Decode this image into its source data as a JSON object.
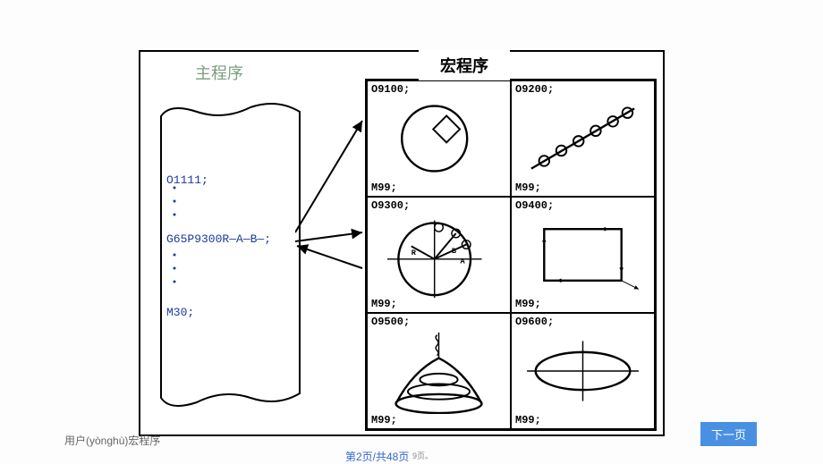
{
  "labels": {
    "main_prog": "主程序",
    "macro_prog": "宏程序"
  },
  "main_program": {
    "prog_num": "O1111;",
    "call_line": "G65P9300R—A—B—;",
    "end": "M30;"
  },
  "cells": [
    {
      "top": "O9100;",
      "bot": "M99;"
    },
    {
      "top": "O9200;",
      "bot": "M99;"
    },
    {
      "top": "O9300;",
      "bot": "M99;"
    },
    {
      "top": "O9400;",
      "bot": "M99;"
    },
    {
      "top": "O9500;",
      "bot": "M99;"
    },
    {
      "top": "O9600;",
      "bot": "M99;"
    }
  ],
  "footer": {
    "left": "用户(yònghù)宏程序",
    "center": "第2页/共48页",
    "small": "9页。",
    "next": "下一页"
  }
}
